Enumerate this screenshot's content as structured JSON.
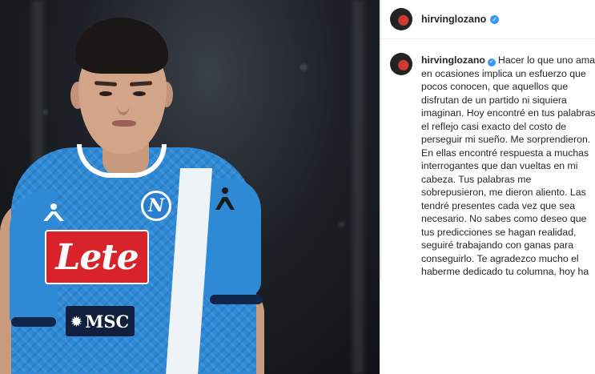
{
  "post": {
    "header": {
      "username": "hirvinglozano",
      "verified": true,
      "avatar_icon": "profile-avatar"
    },
    "caption": {
      "username": "hirvinglozano",
      "text": "Hacer lo que uno ama en ocasiones implica un esfuerzo que pocos conocen, que aquellos que disfrutan de un partido ni siquiera imaginan. Hoy encontré en tus palabras el reflejo casi exacto del costo de perseguir mi sueño. Me sorprendieron. En ellas encontré respuesta a muchas interrogantes que dan vueltas en mi cabeza. Tus palabras me sobrepusieron, me dieron aliento. Las tendré presentes cada vez que sea necesario. No sabes como deseo que tus predicciones se hagan realidad, seguiré trabajando con ganas para conseguirlo. Te agradezco mucho el haberme dedicado tu columna, hoy ha sido un buen día después de haberla leído. Un día más tranquilo y con la alegría"
    }
  },
  "photo": {
    "shirt_sponsor": "Lete",
    "sleeve_sponsor": "MSC",
    "crest_letter": "N",
    "colors": {
      "shirt": "#2f8ad6",
      "sponsor": "#d9232b",
      "navy": "#0f1f3d",
      "background": "#1d2127"
    }
  },
  "colors": {
    "verified_badge": "#3897f0",
    "text": "#262626",
    "divider": "#dbdbdb"
  }
}
